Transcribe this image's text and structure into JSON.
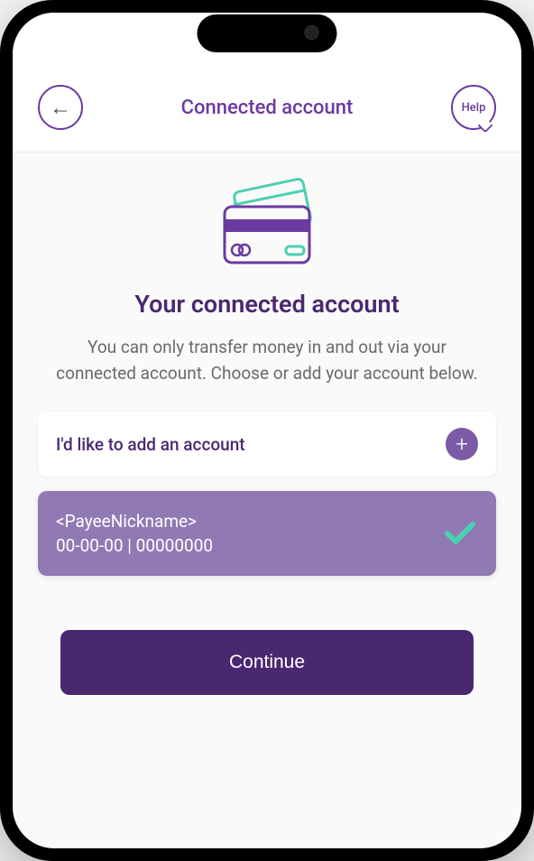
{
  "header": {
    "title": "Connected account",
    "help_label": "Help"
  },
  "main": {
    "title": "Your connected account",
    "description": "You can only transfer money in and out via your connected account. Choose or add your account below.",
    "add_account_label": "I'd like to add an account",
    "account": {
      "nickname": "<PayeeNickname>",
      "number": "00-00-00 | 00000000"
    },
    "continue_label": "Continue"
  },
  "colors": {
    "primary": "#4a2870",
    "accent": "#6b3aa0",
    "success": "#4dd0b1",
    "card_selected": "#9179b3"
  }
}
